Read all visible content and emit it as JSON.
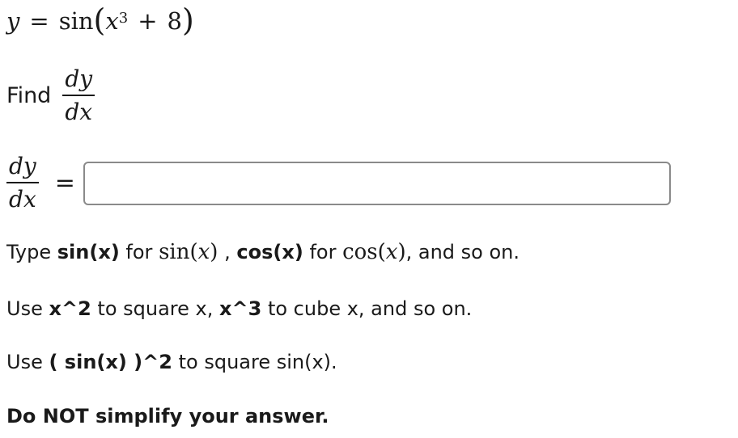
{
  "equation": {
    "lhs_var": "y",
    "equals": "=",
    "func": "sin",
    "open_paren": "(",
    "inner_var": "x",
    "exponent": "3",
    "plus": "+",
    "constant": "8",
    "close_paren": ")"
  },
  "find": {
    "label": "Find",
    "numerator": "dy",
    "denominator": "dx"
  },
  "answer": {
    "numerator": "dy",
    "denominator": "dx",
    "equals": "=",
    "value": "",
    "placeholder": ""
  },
  "instructions": {
    "line1": {
      "type_word": "Type",
      "code1": "sin(x)",
      "for1": "for",
      "math1_func": "sin",
      "math1_open": "(",
      "math1_var": "x",
      "math1_close": ")",
      "comma": ",",
      "code2": "cos(x)",
      "for2": "for",
      "math2_func": "cos",
      "math2_open": "(",
      "math2_var": "x",
      "math2_close": ")",
      "tail": ", and so on."
    },
    "line2": {
      "use_word": "Use",
      "code1": "x^2",
      "mid": "to square x,",
      "code2": "x^3",
      "tail": "to cube x, and so on."
    },
    "line3": {
      "use_word": "Use",
      "code": "( sin(x) )^2",
      "tail": "to square sin(x)."
    },
    "line4": {
      "text": "Do NOT simplify your answer."
    }
  }
}
